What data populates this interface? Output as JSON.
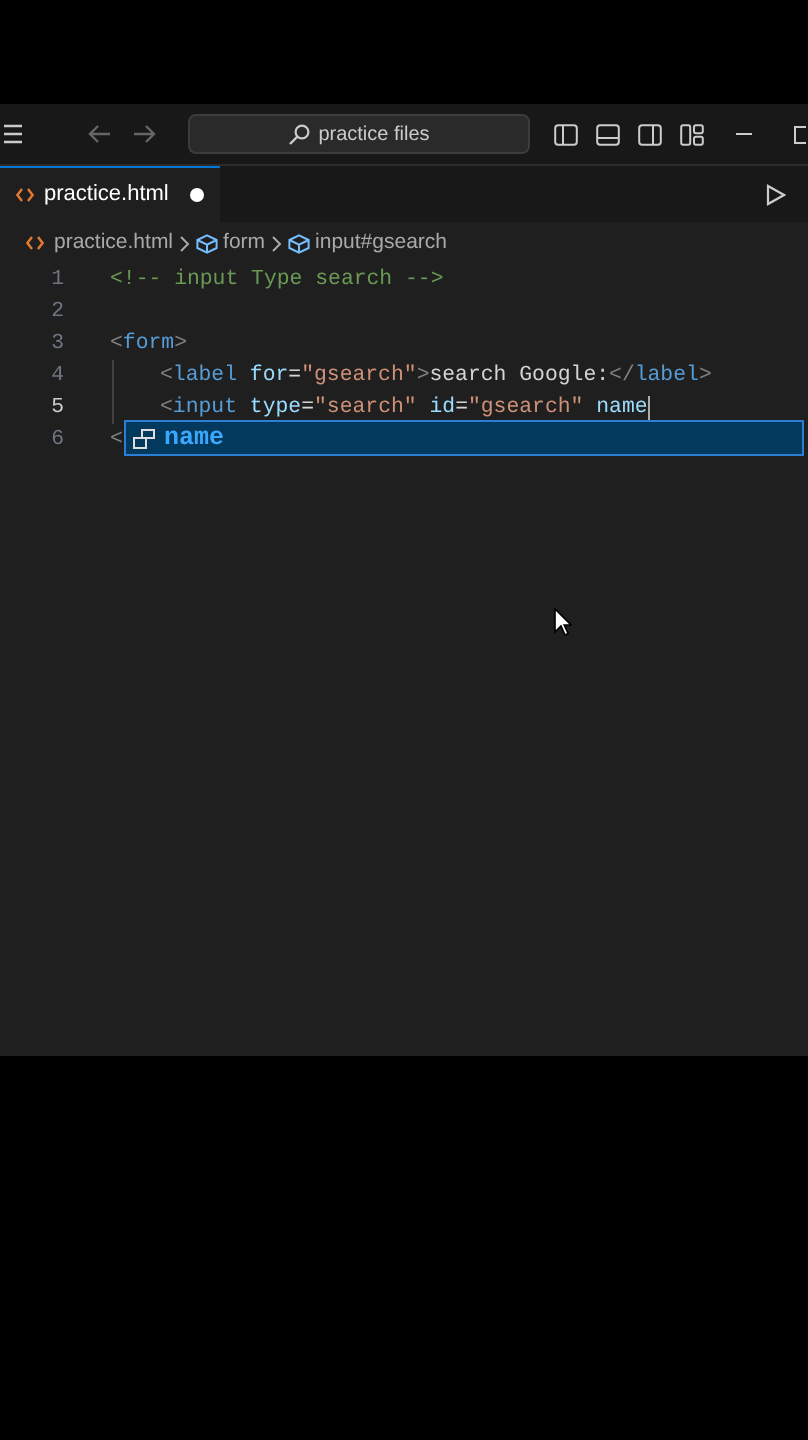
{
  "title_bar": {
    "search": "practice files"
  },
  "tabs": [
    {
      "label": "practice.html",
      "selected": true,
      "modified": true
    }
  ],
  "breadcrumbs": [
    "practice.html",
    "form",
    "input#gsearch"
  ],
  "lines": [
    {
      "number": "1",
      "current": false,
      "tokens": [
        {
          "kind": "comment",
          "text": "<!-- input Type search -->"
        }
      ]
    },
    {
      "number": "2",
      "current": false
    },
    {
      "number": "3",
      "current": false,
      "tokens": [
        {
          "kind": "bracket",
          "text": "<"
        },
        {
          "kind": "tag",
          "text": "form"
        },
        {
          "kind": "bracket",
          "text": ">"
        }
      ]
    },
    {
      "number": "4",
      "current": false,
      "indent": true,
      "tokens": [
        {
          "kind": "bracket",
          "text": "<"
        },
        {
          "kind": "tag",
          "text": "label"
        },
        {
          "kind": "attr",
          "text": " for"
        },
        {
          "kind": "plain",
          "text": "="
        },
        {
          "kind": "string",
          "text": "\"gsearch\""
        },
        {
          "kind": "bracket",
          "text": ">"
        },
        {
          "kind": "plain",
          "text": "search Google:"
        },
        {
          "kind": "bracket",
          "text": "</"
        },
        {
          "kind": "tag",
          "text": "label"
        },
        {
          "kind": "bracket",
          "text": ">"
        }
      ]
    },
    {
      "number": "5",
      "current": true,
      "indent": true,
      "tokens": [
        {
          "kind": "bracket",
          "text": "<"
        },
        {
          "kind": "tag",
          "text": "input"
        },
        {
          "kind": "attr",
          "text": " type"
        },
        {
          "kind": "plain",
          "text": "="
        },
        {
          "kind": "string",
          "text": "\"search\""
        },
        {
          "kind": "attr",
          "text": " id"
        },
        {
          "kind": "plain",
          "text": "="
        },
        {
          "kind": "string",
          "text": "\"gsearch\""
        },
        {
          "kind": "attr",
          "text": " name"
        }
      ]
    },
    {
      "number": "6",
      "current": false,
      "tokens": [
        {
          "kind": "bracket",
          "text": "<"
        }
      ]
    }
  ],
  "suggestion": {
    "label": "name"
  }
}
